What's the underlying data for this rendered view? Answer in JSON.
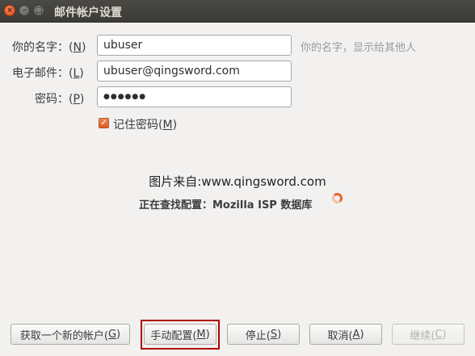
{
  "window": {
    "title": "邮件帐户设置",
    "close_glyph": "×",
    "min_glyph": "–",
    "max_glyph": "□"
  },
  "form": {
    "name_label_pre": "你的名字：(",
    "name_label_key": "N",
    "name_label_post": ")",
    "name_value": "ubuser",
    "name_hint": "你的名字，显示给其他人",
    "email_label_pre": "电子邮件：(",
    "email_label_key": "L",
    "email_label_post": ")",
    "email_value": "ubuser@qingsword.com",
    "password_label_pre": "密码：(",
    "password_label_key": "P",
    "password_label_post": ")",
    "password_value": "●●●●●●",
    "remember_checked_glyph": "✓",
    "remember_label_pre": "记住密码(",
    "remember_label_key": "M",
    "remember_label_post": ")"
  },
  "source_text": "图片来自:www.qingsword.com",
  "status_text": "正在查找配置：Mozilla ISP 数据库",
  "buttons": {
    "new_account_pre": "获取一个新的帐户(",
    "new_account_key": "G",
    "new_account_post": ")",
    "manual_pre": "手动配置(",
    "manual_key": "M",
    "manual_post": ")",
    "stop_pre": "停止(",
    "stop_key": "S",
    "stop_post": ")",
    "cancel_pre": "取消(",
    "cancel_key": "A",
    "cancel_post": ")",
    "continue_pre": "继续(",
    "continue_key": "C",
    "continue_post": ")"
  },
  "colors": {
    "accent": "#e8642d",
    "highlight_box": "#b00000"
  }
}
